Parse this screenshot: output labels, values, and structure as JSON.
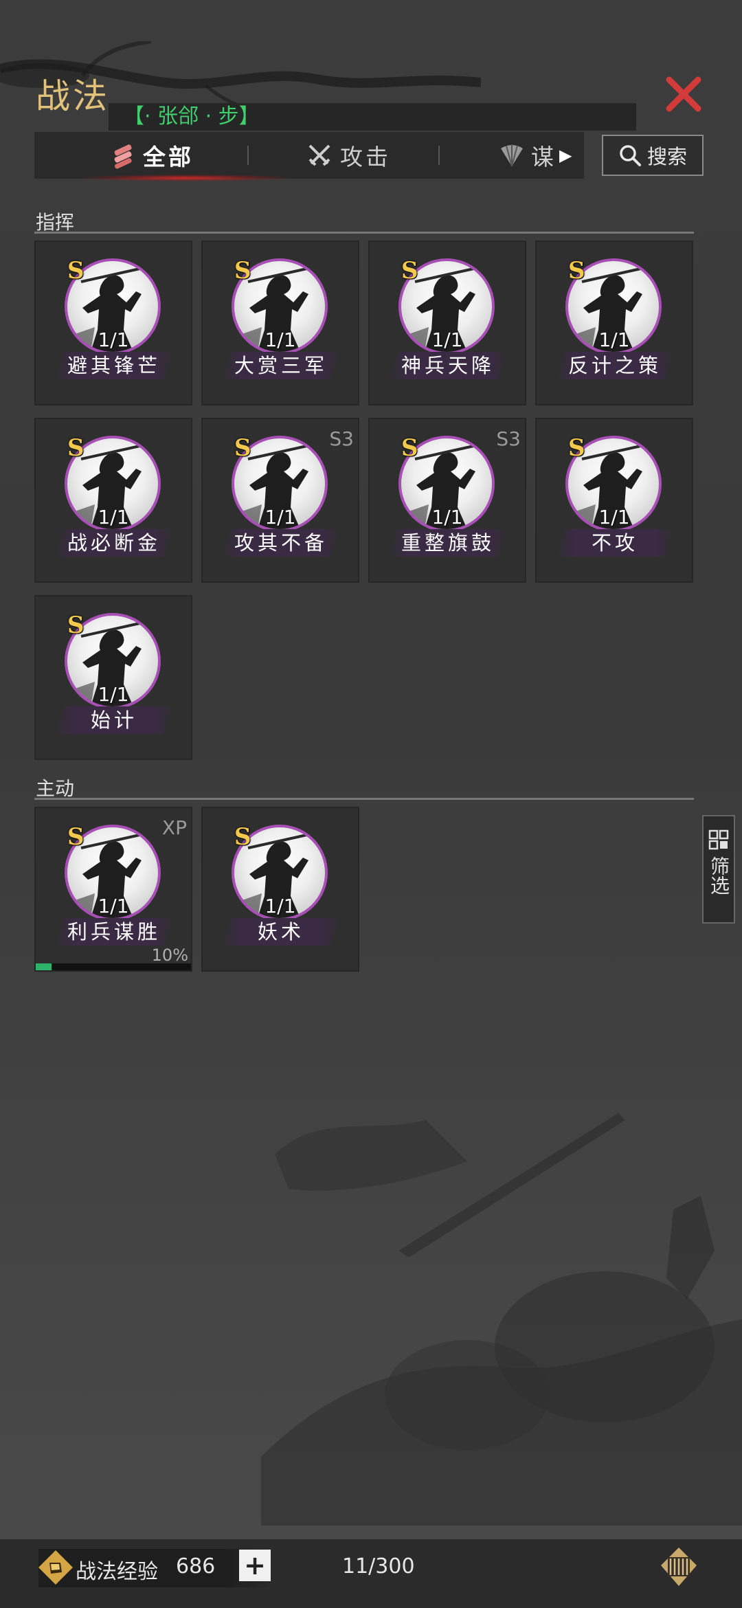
{
  "header": {
    "title": "战法",
    "general": "【· 张郃 · 步】"
  },
  "tabs": [
    {
      "label": "全部",
      "icon": "all-tactics-icon",
      "active": true
    },
    {
      "label": "攻击",
      "icon": "crossed-swords-icon",
      "active": false
    },
    {
      "label": "谋",
      "icon": "strategy-fan-icon",
      "active": false
    }
  ],
  "search": {
    "label": "搜索"
  },
  "sections": {
    "command": {
      "title": "指挥",
      "cards": [
        {
          "grade": "S",
          "level": "1/1",
          "name": "避其锋芒",
          "tag": ""
        },
        {
          "grade": "S",
          "level": "1/1",
          "name": "大赏三军",
          "tag": ""
        },
        {
          "grade": "S",
          "level": "1/1",
          "name": "神兵天降",
          "tag": ""
        },
        {
          "grade": "S",
          "level": "1/1",
          "name": "反计之策",
          "tag": ""
        },
        {
          "grade": "S",
          "level": "1/1",
          "name": "战必断金",
          "tag": ""
        },
        {
          "grade": "S",
          "level": "1/1",
          "name": "攻其不备",
          "tag": "S3"
        },
        {
          "grade": "S",
          "level": "1/1",
          "name": "重整旗鼓",
          "tag": "S3"
        },
        {
          "grade": "S",
          "level": "1/1",
          "name": "不攻",
          "tag": ""
        },
        {
          "grade": "S",
          "level": "1/1",
          "name": "始计",
          "tag": ""
        }
      ]
    },
    "active": {
      "title": "主动",
      "cards": [
        {
          "grade": "S",
          "level": "1/1",
          "name": "利兵谋胜",
          "tag": "XP",
          "progress": "10%",
          "progress_value": 0.1
        },
        {
          "grade": "S",
          "level": "1/1",
          "name": "妖术",
          "tag": ""
        }
      ]
    }
  },
  "filter": {
    "label": "筛选"
  },
  "footer": {
    "xp_label": "战法经验",
    "xp_value": "686",
    "plus": "+",
    "count": "11/300"
  },
  "colors": {
    "title_gold": "#e2c27a",
    "general_green": "#3fd06b",
    "close_red": "#d33a3a",
    "ring_purple": "#a84fb6",
    "grade_gold": "#f2c94c",
    "xp_green": "#2fb36a"
  }
}
